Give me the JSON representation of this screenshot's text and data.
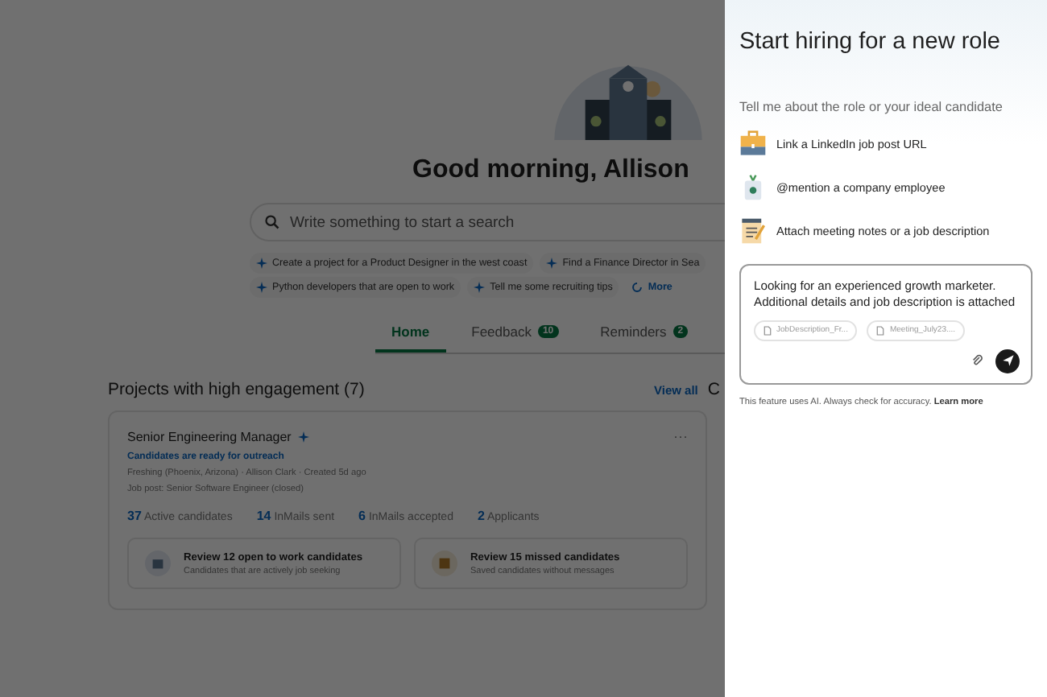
{
  "greeting": "Good morning, Allison",
  "search": {
    "placeholder": "Write something to start a search"
  },
  "suggestion_rows": [
    [
      {
        "kind": "prompt",
        "label": "Create a project for a Product Designer in the west coast"
      },
      {
        "kind": "prompt",
        "label": "Find a Finance Director in Sea"
      }
    ],
    [
      {
        "kind": "prompt",
        "label": "Python developers that are open to work"
      },
      {
        "kind": "prompt",
        "label": "Tell me some recruiting tips"
      },
      {
        "kind": "more",
        "label": "More"
      }
    ]
  ],
  "tabs": [
    {
      "label": "Home",
      "selected": true
    },
    {
      "label": "Feedback",
      "count": "10",
      "selected": false
    },
    {
      "label": "Reminders",
      "count": "2",
      "selected": false
    }
  ],
  "projects": {
    "title": "Projects with high engagement (7)",
    "view_all": "View all",
    "next_section_cut": "C",
    "card": {
      "title": "Senior Engineering Manager",
      "menu": "···",
      "status": "Candidates are ready for outreach",
      "meta": "Freshing (Phoenix, Arizona) · Allison Clark · Created 5d ago",
      "job_post": "Job post: Senior Software Engineer (closed)",
      "stats": [
        {
          "value": "37",
          "label": "Active candidates"
        },
        {
          "value": "14",
          "label": "InMails sent"
        },
        {
          "value": "6",
          "label": "InMails accepted"
        },
        {
          "value": "2",
          "label": "Applicants"
        }
      ],
      "actions": [
        {
          "kind": "open",
          "title": "Review 12 open to work candidates",
          "subtitle": "Candidates that are actively job seeking"
        },
        {
          "kind": "missed",
          "title": "Review 15 missed candidates",
          "subtitle": "Saved candidates without messages"
        }
      ]
    }
  },
  "panel": {
    "title": "Start hiring for a new role",
    "prompt": "Tell me about the role or your ideal candidate",
    "options": [
      {
        "kind": "briefcase",
        "label": "Link a LinkedIn job post URL"
      },
      {
        "kind": "badge",
        "label": "@mention a company employee"
      },
      {
        "kind": "notes",
        "label": "Attach meeting notes or a job description"
      }
    ],
    "message": "Looking for an experienced growth marketer. Additional details and job description is attached",
    "attachments": [
      "JobDescription_Fr...",
      "Meeting_July23...."
    ],
    "disclaimer": "This feature uses AI. Always check for accuracy.",
    "learn_more": "Learn more"
  }
}
